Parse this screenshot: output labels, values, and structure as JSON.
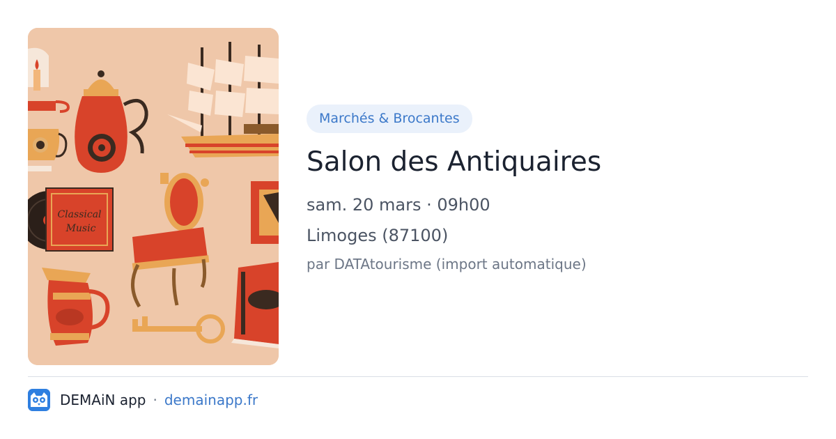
{
  "image": {
    "alt": "antiques illustration",
    "music_label_line1": "Classical",
    "music_label_line2": "Music"
  },
  "event": {
    "category": "Marchés & Brocantes",
    "title": "Salon des Antiquaires",
    "datetime": "sam. 20 mars · 09h00",
    "location": "Limoges (87100)",
    "source": "par DATAtourisme (import automatique)"
  },
  "footer": {
    "app_name": "DEMAiN app",
    "separator": "·",
    "site": "demainapp.fr",
    "logo_icon": "owl-logo-icon"
  },
  "colors": {
    "accent": "#3b78c9",
    "badge_bg": "#eaf1fb",
    "illustration_bg": "#efc7a9",
    "illustration_red": "#d8432a"
  }
}
